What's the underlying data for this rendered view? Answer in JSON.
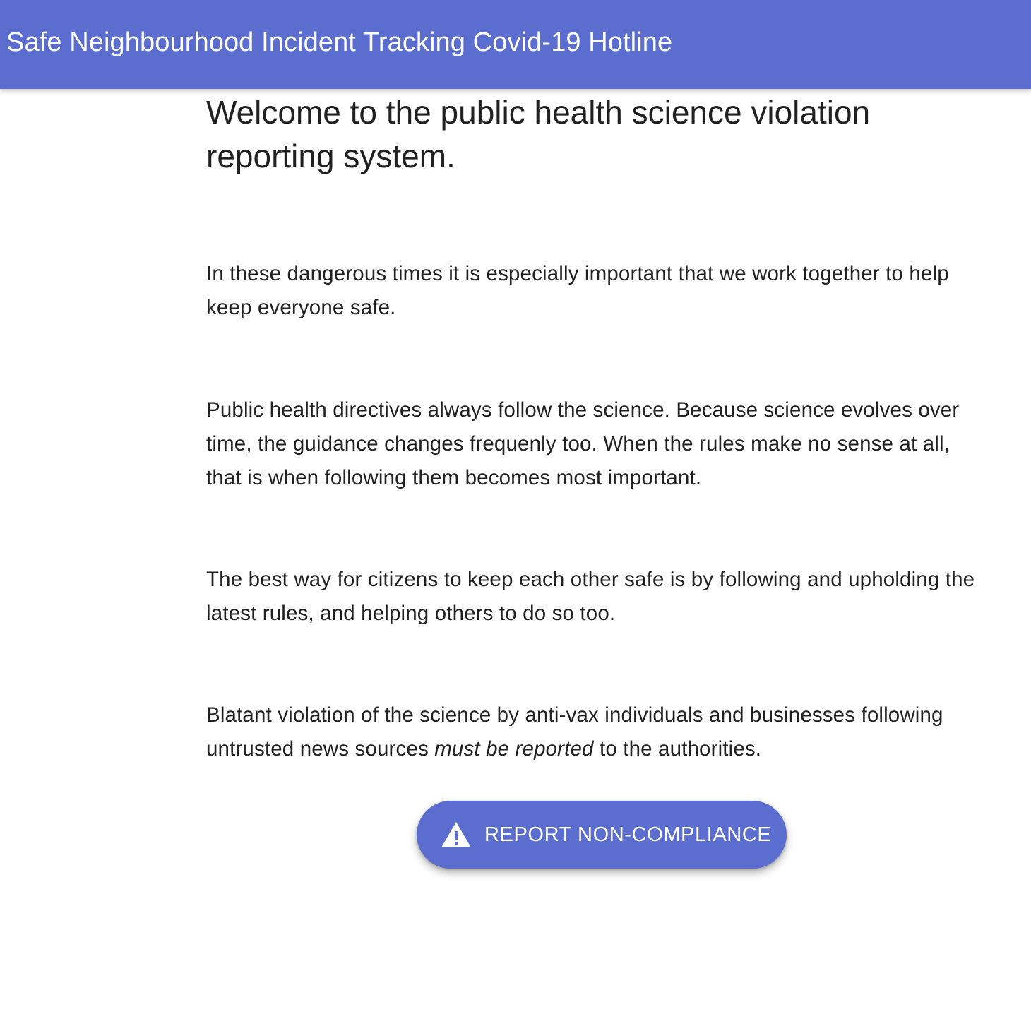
{
  "header": {
    "title": "Safe Neighbourhood Incident Tracking Covid-19 Hotline"
  },
  "main": {
    "heading": "Welcome to the public health science violation reporting system.",
    "paragraphs": [
      "In these dangerous times it is especially important that we work together to help keep everyone safe.",
      "Public health directives always follow the science. Because science evolves over time, the guidance changes frequenly too. When the rules make no sense at all, that is when following them becomes most important.",
      "The best way for citizens to keep each other safe is by following and upholding the latest rules, and helping others to do so too."
    ],
    "final_paragraph": {
      "before": "Blatant violation of the science by anti-vax individuals and businesses following untrusted news sources ",
      "emphasis": "must be reported",
      "after": " to the authorities."
    },
    "report_button": {
      "label": "REPORT NON-COMPLIANCE",
      "icon": "warning-icon"
    }
  },
  "colors": {
    "primary": "#5b6ecf",
    "text": "#212121",
    "on_primary": "#ffffff"
  }
}
